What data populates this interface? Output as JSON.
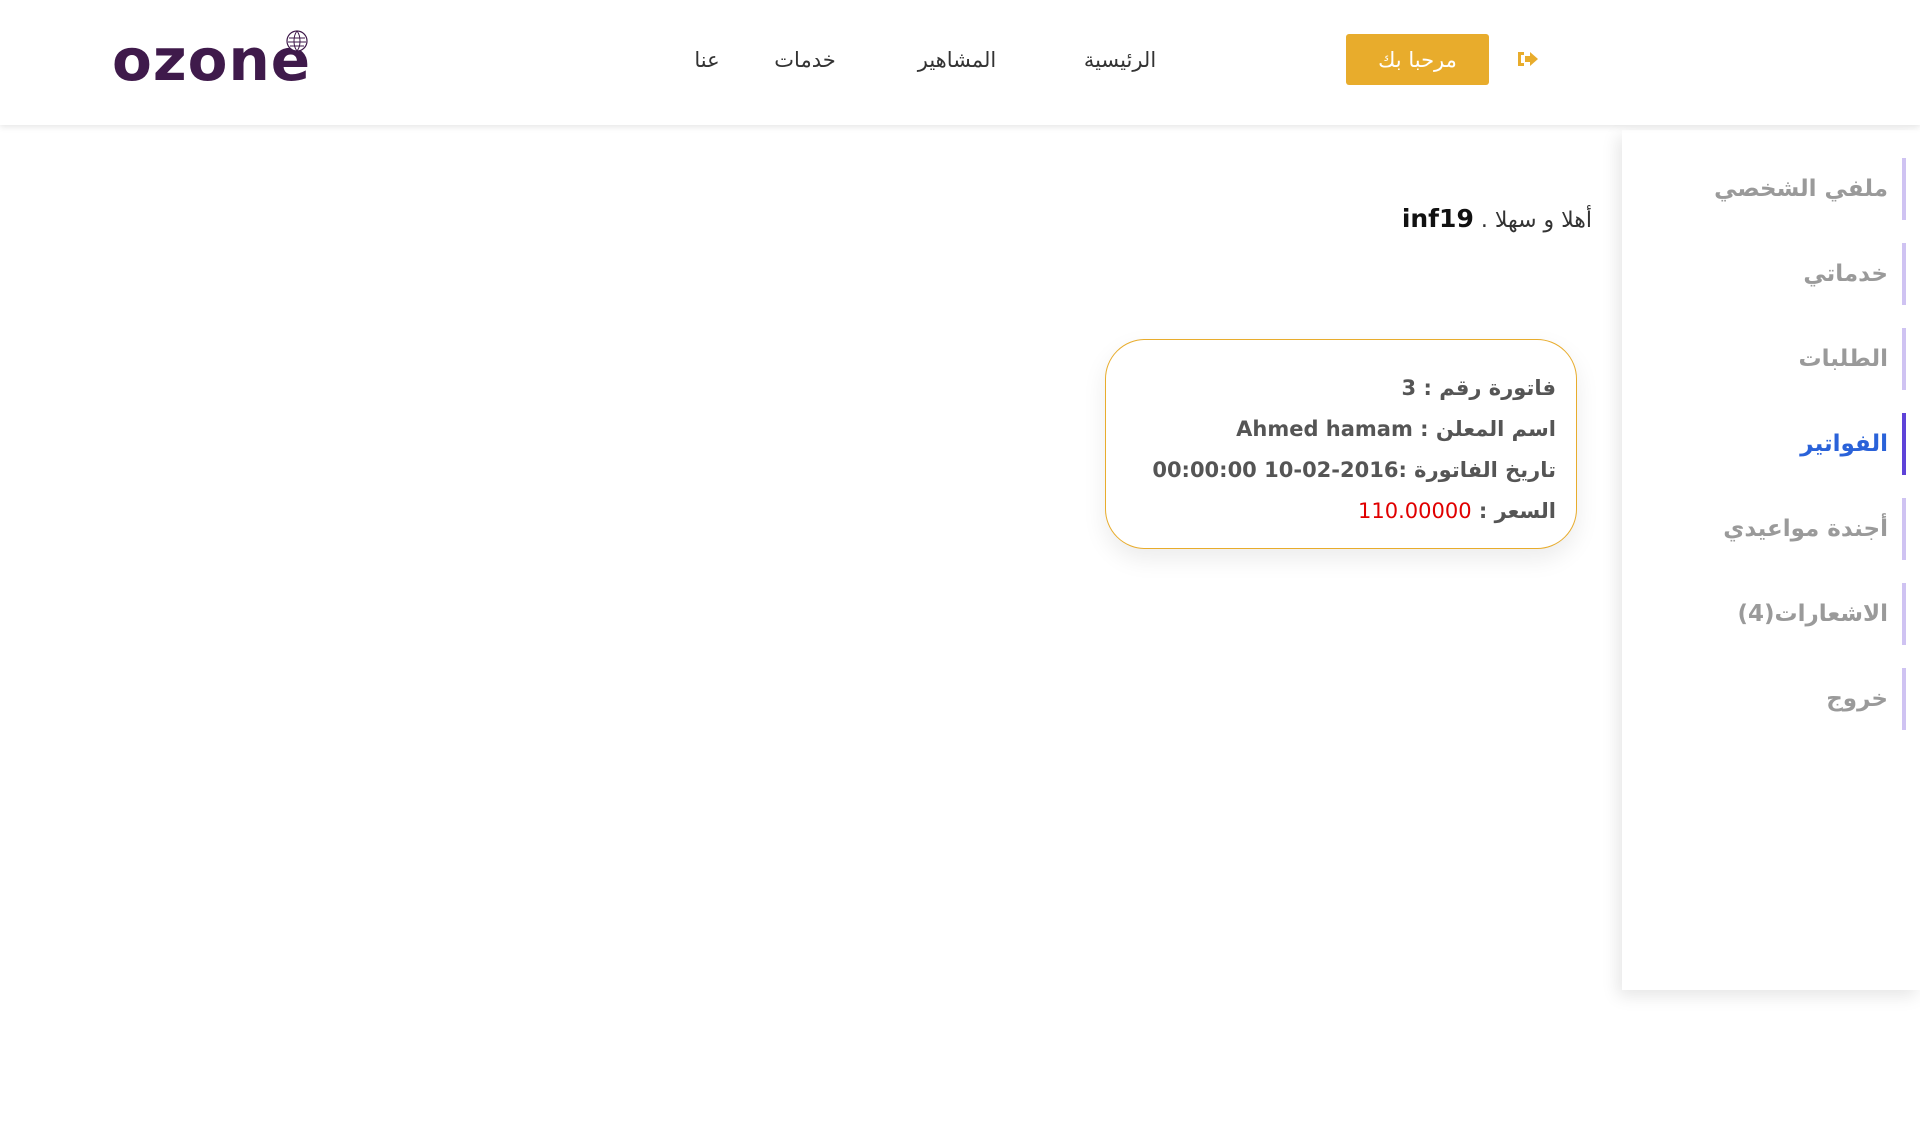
{
  "header": {
    "logo_text": "ozon",
    "logo_last": "e",
    "nav": {
      "home": "الرئيسية",
      "celebrities": "المشاهير",
      "services": "خدمات",
      "about": "عنا"
    },
    "welcome_button": "مرحبا بك",
    "logout_icon": "sign-out-icon"
  },
  "greeting": {
    "prefix": "أهلا و سهلا .",
    "username": "inf19"
  },
  "sidebar": {
    "items": [
      {
        "label": "ملفي الشخصي"
      },
      {
        "label": "خدماتي"
      },
      {
        "label": "الطلبات"
      },
      {
        "label": "الفواتير"
      },
      {
        "label": "أجندة مواعيدي"
      },
      {
        "label": "الاشعارات(4)"
      },
      {
        "label": "خروج"
      }
    ],
    "active_index": 3
  },
  "invoice": {
    "number_label": "فاتورة رقم :",
    "number_value": "3",
    "advertiser_label": "اسم المعلن :",
    "advertiser_value": "Ahmed hamam",
    "date_label": "تاريخ الفاتورة :",
    "date_value": "2016-02-10 00:00:00",
    "price_label": "السعر :",
    "price_value": "110.00000"
  },
  "colors": {
    "accent": "#e8ac2c",
    "brand": "#3f1a4b",
    "active_link": "#2a62d9",
    "price": "#e00000"
  }
}
